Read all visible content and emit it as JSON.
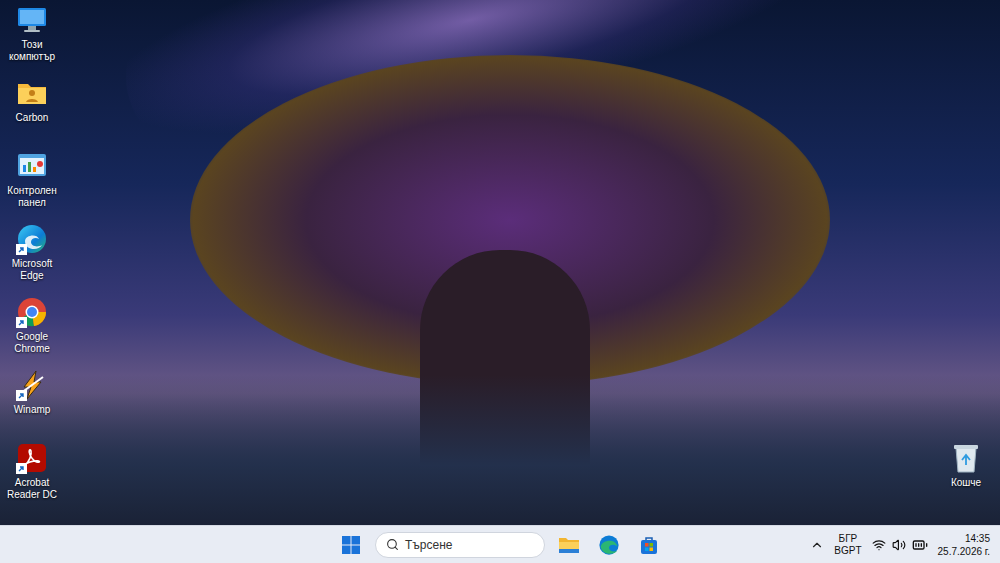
{
  "desktop": {
    "icons": [
      {
        "label": "Този компютър",
        "kind": "computer",
        "shortcut": false
      },
      {
        "label": "Carbon",
        "kind": "folder",
        "shortcut": false
      },
      {
        "label": "Контролен панел",
        "kind": "control-panel",
        "shortcut": false
      },
      {
        "label": "Microsoft Edge",
        "kind": "edge",
        "shortcut": true
      },
      {
        "label": "Google Chrome",
        "kind": "chrome",
        "shortcut": true
      },
      {
        "label": "Winamp",
        "kind": "winamp",
        "shortcut": true
      },
      {
        "label": "Acrobat Reader DC",
        "kind": "acrobat",
        "shortcut": true
      }
    ],
    "recycle_bin": {
      "label": "Кошче"
    }
  },
  "taskbar": {
    "search": {
      "placeholder": "Търсене"
    },
    "tray": {
      "language": "БГР",
      "layout": "BGPT"
    },
    "clock": {
      "time": "14:35",
      "date": "25.7.2026 г."
    }
  }
}
